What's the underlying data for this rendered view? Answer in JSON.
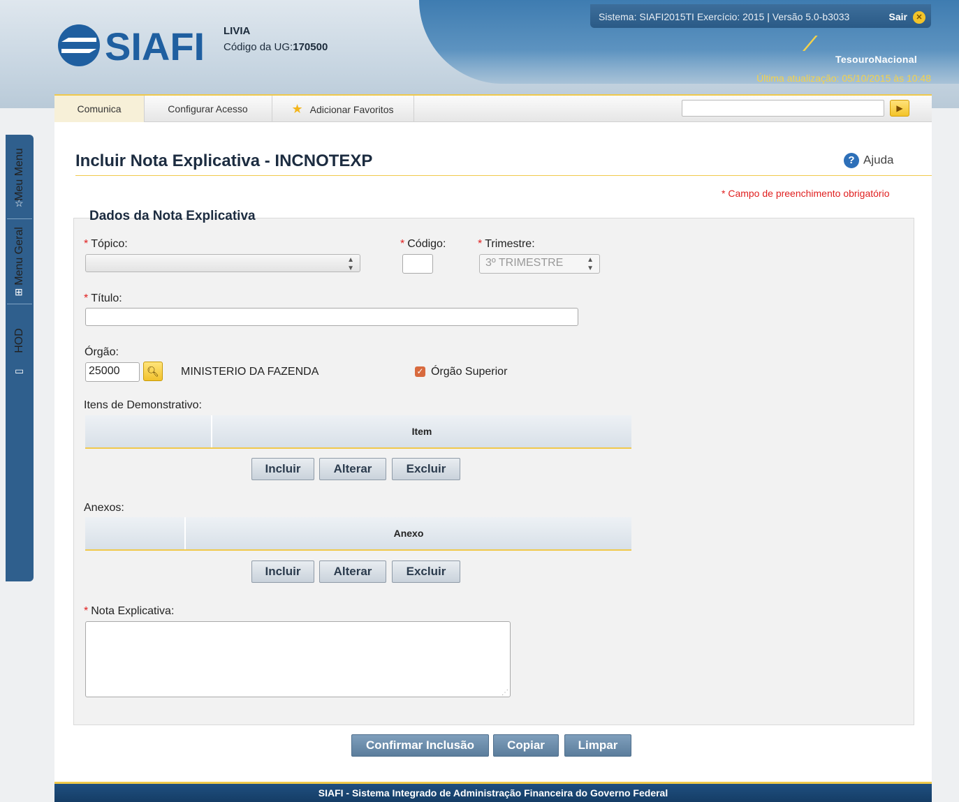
{
  "header": {
    "user_name": "LIVIA",
    "ug_label": "Código da UG:",
    "ug_value": "170500",
    "system_info": "Sistema: SIAFI2015TI Exercício: 2015",
    "version": "Versão 5.0-b3033",
    "sair_label": "Sair",
    "org_name": "TesouroNacional",
    "last_update": "Última atualização: 05/10/2015 às 10:48",
    "colors": {
      "accent": "#f0c94b",
      "brand_blue": "#2d6fa8"
    }
  },
  "menubar": {
    "items": [
      "Comunica",
      "Configurar Acesso",
      "Adicionar Favoritos"
    ],
    "search_value": ""
  },
  "sidebar": {
    "tabs": [
      "Meu Menu",
      "Menu Geral",
      "HOD"
    ]
  },
  "page": {
    "title": "Incluir Nota Explicativa - INCNOTEXP",
    "help_label": "Ajuda",
    "required_note": "* Campo de preenchimento obrigatório",
    "section_title": "Dados da Nota Explicativa"
  },
  "form": {
    "topico_label": "Tópico:",
    "topico_value": "",
    "codigo_label": "Código:",
    "codigo_value": "",
    "trimestre_label": "Trimestre:",
    "trimestre_value": "3º TRIMESTRE",
    "titulo_label": "Título:",
    "titulo_value": "",
    "orgao_label": "Órgão:",
    "orgao_value": "25000",
    "orgao_name": "MINISTERIO DA FAZENDA",
    "orgao_superior_label": "Órgão Superior",
    "orgao_superior_checked": true,
    "itens_label": "Itens de Demonstrativo:",
    "itens_column": "Item",
    "anexos_label": "Anexos:",
    "anexos_column": "Anexo",
    "btn_incluir": "Incluir",
    "btn_alterar": "Alterar",
    "btn_excluir": "Excluir",
    "nota_label": "Nota Explicativa:",
    "nota_value": ""
  },
  "actions": {
    "confirmar": "Confirmar Inclusão",
    "copiar": "Copiar",
    "limpar": "Limpar"
  },
  "footer": {
    "text": "SIAFI - Sistema Integrado de Administração Financeira do Governo Federal"
  }
}
